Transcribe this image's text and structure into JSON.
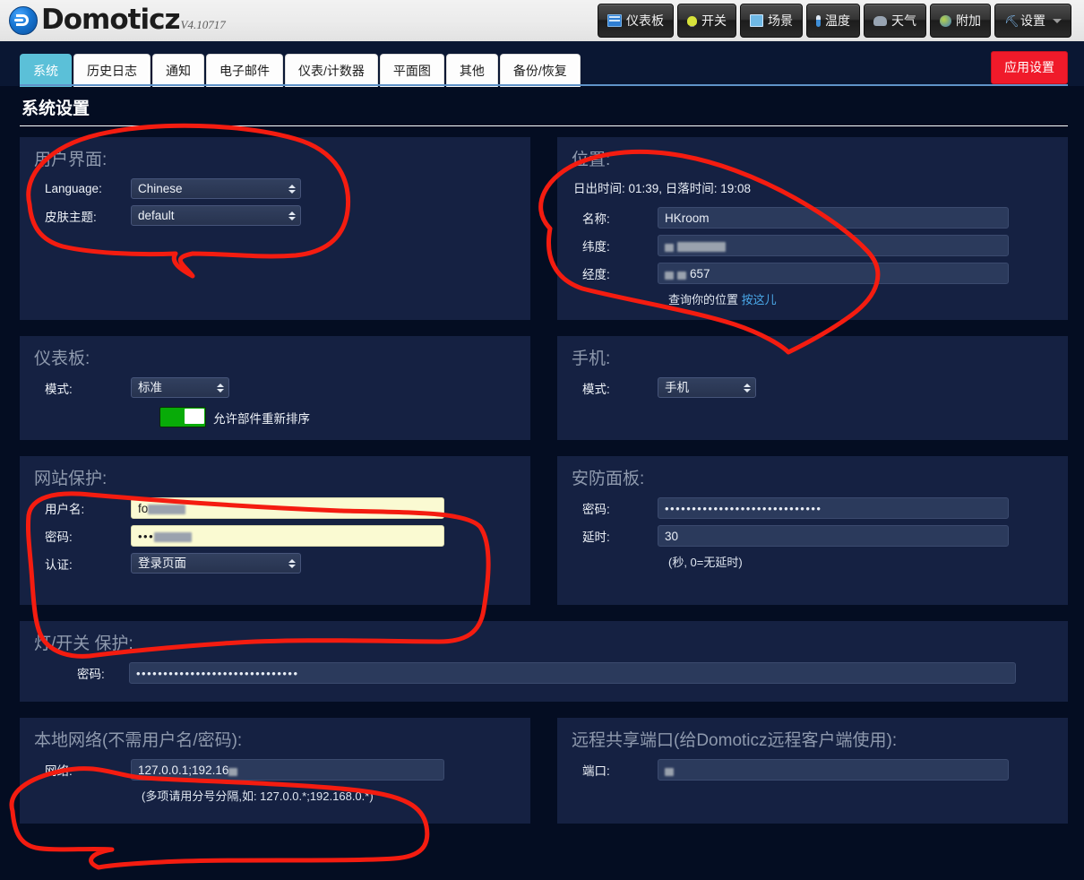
{
  "header": {
    "brand": "Domoticz",
    "version": "V4.10717",
    "nav": [
      {
        "label": "仪表板",
        "icon": "dashboard-icon"
      },
      {
        "label": "开关",
        "icon": "lightbulb-icon"
      },
      {
        "label": "场景",
        "icon": "scene-icon"
      },
      {
        "label": "温度",
        "icon": "thermometer-icon"
      },
      {
        "label": "天气",
        "icon": "weather-cloud-icon"
      },
      {
        "label": "附加",
        "icon": "globe-icon"
      },
      {
        "label": "设置",
        "icon": "tools-icon",
        "caret": true
      }
    ]
  },
  "tabs": [
    {
      "label": "系统",
      "active": true
    },
    {
      "label": "历史日志",
      "active": false
    },
    {
      "label": "通知",
      "active": false
    },
    {
      "label": "电子邮件",
      "active": false
    },
    {
      "label": "仪表/计数器",
      "active": false
    },
    {
      "label": "平面图",
      "active": false
    },
    {
      "label": "其他",
      "active": false
    },
    {
      "label": "备份/恢复",
      "active": false
    }
  ],
  "apply_button": "应用设置",
  "page_title": "系统设置",
  "ui_panel": {
    "title": "用户界面:",
    "language_label": "Language:",
    "language_value": "Chinese",
    "theme_label": "皮肤主题:",
    "theme_value": "default"
  },
  "location_panel": {
    "title": "位置:",
    "sun_line": "日出时间: 01:39, 日落时间: 19:08",
    "name_label": "名称:",
    "name_value": "HKroom",
    "latitude_label": "纬度:",
    "latitude_value": "",
    "longitude_label": "经度:",
    "longitude_value": "657",
    "lookup_text": "查询你的位置",
    "lookup_link": "按这儿"
  },
  "dashboard_panel": {
    "title": "仪表板:",
    "mode_label": "模式:",
    "mode_value": "标准",
    "toggle_label": "允许部件重新排序",
    "toggle_on": true
  },
  "mobile_panel": {
    "title": "手机:",
    "mode_label": "模式:",
    "mode_value": "手机"
  },
  "website_protection_panel": {
    "title": "网站保护:",
    "username_label": "用户名:",
    "username_value": "fo",
    "password_label": "密码:",
    "password_value": "•••",
    "auth_label": "认证:",
    "auth_value": "登录页面"
  },
  "security_panel": {
    "title": "安防面板:",
    "password_label": "密码:",
    "password_value": "•••••••••••••••••••••••••••••",
    "delay_label": "延时:",
    "delay_value": "30",
    "delay_hint": "(秒, 0=无延时)"
  },
  "light_switch_panel": {
    "title": "灯/开关 保护:",
    "password_label": "密码:",
    "password_value": "••••••••••••••••••••••••••••••"
  },
  "local_network_panel": {
    "title": "本地网络(不需用户名/密码):",
    "network_label": "网络:",
    "network_value": "127.0.0.1;192.16",
    "network_hint": "(多项请用分号分隔,如: 127.0.0.*;192.168.0.*)"
  },
  "remote_share_panel": {
    "title": "远程共享端口(给Domoticz远程客户端使用):",
    "port_label": "端口:",
    "port_value": ""
  },
  "colors": {
    "accent_tab": "#5bc0d8",
    "apply_button": "#f01a2a",
    "panel_bg": "#152142",
    "page_bg": "#040d22",
    "link": "#4aa8e8",
    "toggle_on": "#08ab08",
    "autofill": "#fafad2",
    "annotation_ink": "#f41c10"
  }
}
